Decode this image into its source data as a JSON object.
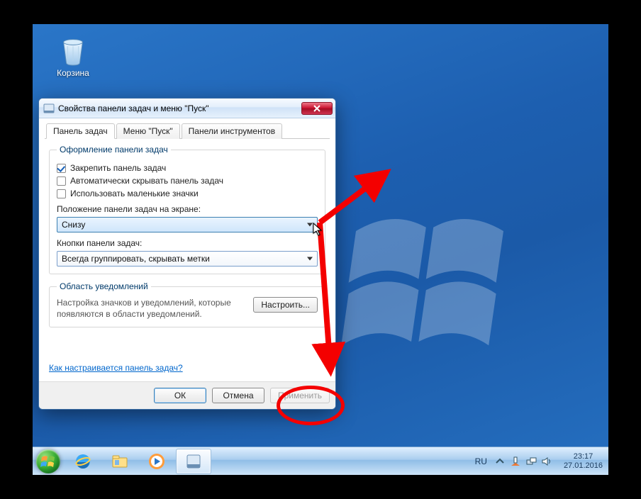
{
  "desktop": {
    "recycle_bin_label": "Корзина"
  },
  "dialog": {
    "title": "Свойства панели задач и меню \"Пуск\"",
    "tabs": {
      "taskbar": "Панель задач",
      "startmenu": "Меню \"Пуск\"",
      "toolbars": "Панели инструментов"
    },
    "appearance_group": "Оформление панели задач",
    "checks": {
      "lock": "Закрепить панель задач",
      "autohide": "Автоматически скрывать панель задач",
      "small_icons": "Использовать маленькие значки"
    },
    "position_label": "Положение панели задач на экране:",
    "position_value": "Снизу",
    "buttons_label": "Кнопки панели задач:",
    "buttons_value": "Всегда группировать, скрывать метки",
    "notify_group": "Область уведомлений",
    "notify_text": "Настройка значков и уведомлений, которые появляются в области уведомлений.",
    "configure_btn": "Настроить...",
    "help_link": "Как настраивается панель задач?",
    "ok": "ОК",
    "cancel": "Отмена",
    "apply": "Применить"
  },
  "taskbar": {
    "lang": "RU",
    "time": "23:17",
    "date": "27.01.2016"
  }
}
